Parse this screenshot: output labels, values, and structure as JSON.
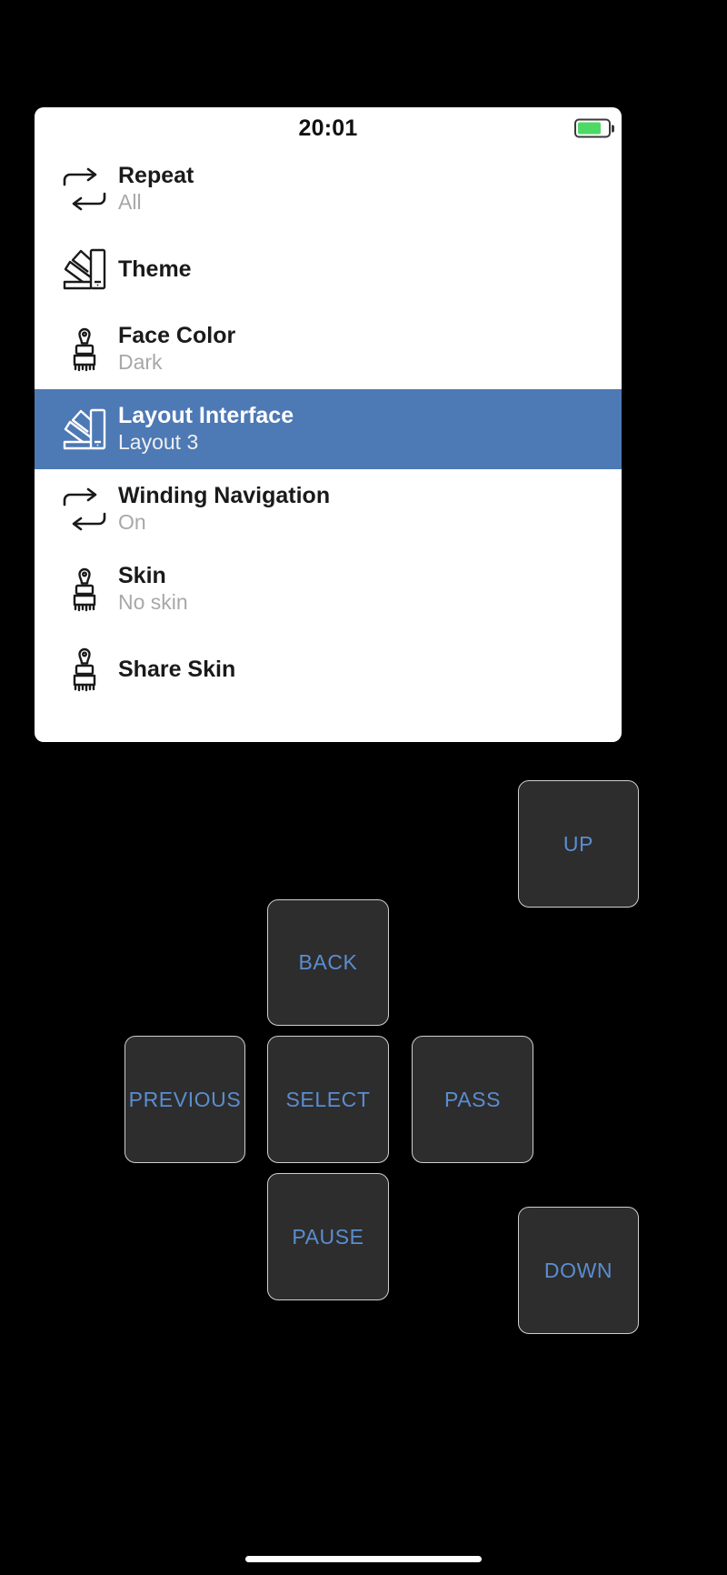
{
  "device": {
    "background_color": "#000000",
    "screen_background": "#ffffff"
  },
  "statusbar": {
    "clock": "20:01",
    "battery_icon": "battery-icon",
    "battery_level_percent": 78,
    "battery_color": "#4cd964"
  },
  "menu": {
    "selected_index": 3,
    "highlight_color": "#4d79b5",
    "items": [
      {
        "icon": "repeat-loop-icon",
        "title": "Repeat",
        "subtitle": "All"
      },
      {
        "icon": "color-swatch-icon",
        "title": "Theme",
        "subtitle": ""
      },
      {
        "icon": "paint-brush-icon",
        "title": "Face Color",
        "subtitle": "Dark"
      },
      {
        "icon": "color-swatch-icon",
        "title": "Layout Interface",
        "subtitle": "Layout 3"
      },
      {
        "icon": "repeat-loop-icon",
        "title": "Winding Navigation",
        "subtitle": "On"
      },
      {
        "icon": "paint-brush-icon",
        "title": "Skin",
        "subtitle": "No skin"
      },
      {
        "icon": "paint-brush-icon",
        "title": "Share Skin",
        "subtitle": ""
      }
    ]
  },
  "controls": {
    "text_color": "#5b8dd0",
    "button_background": "#2d2d2d",
    "buttons": {
      "up": "UP",
      "back": "BACK",
      "previous": "PREVIOUS",
      "select": "SELECT",
      "pass": "PASS",
      "pause": "PAUSE",
      "down": "DOWN"
    }
  }
}
